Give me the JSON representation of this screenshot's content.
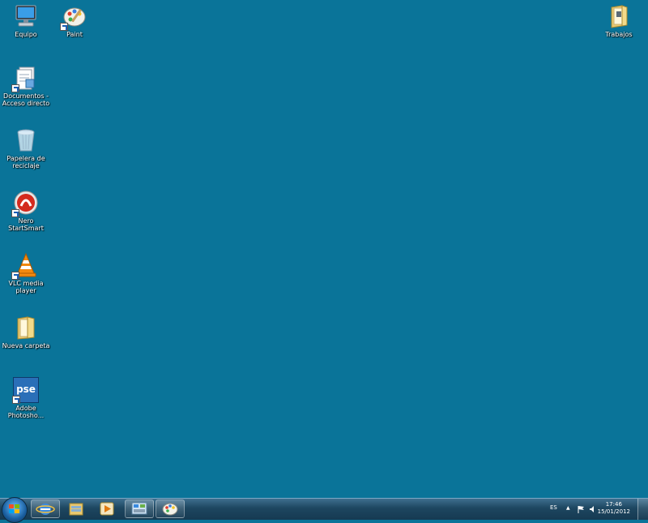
{
  "desktop": {
    "background_color": "#0a7499",
    "icons": [
      {
        "label": "Equipo",
        "icon": "computer-icon"
      },
      {
        "label": "Paint",
        "icon": "paint-icon"
      },
      {
        "label": "Trabajos",
        "icon": "folder-icon"
      },
      {
        "label": "Documentos -\nAcceso directo",
        "icon": "documents-icon"
      },
      {
        "label": "Papelera de\nreciclaje",
        "icon": "recycle-bin-icon"
      },
      {
        "label": "Nero StartSmart",
        "icon": "nero-icon"
      },
      {
        "label": "VLC media player",
        "icon": "vlc-icon"
      },
      {
        "label": "Nueva carpeta",
        "icon": "folder-icon"
      },
      {
        "label": "Adobe\nPhotosho...",
        "icon": "photoshop-elements-icon",
        "badge_text": "pse"
      }
    ]
  },
  "taskbar": {
    "pinned": [
      {
        "name": "internet-explorer",
        "icon": "internet-explorer-icon"
      },
      {
        "name": "windows-explorer",
        "icon": "folder-icon"
      },
      {
        "name": "media-player",
        "icon": "media-player-icon"
      },
      {
        "name": "control-panel",
        "icon": "control-panel-icon"
      },
      {
        "name": "paint",
        "icon": "paint-icon"
      }
    ],
    "language": "ES",
    "tray_arrow": "▲",
    "time": "17:46",
    "date": "15/01/2012"
  }
}
